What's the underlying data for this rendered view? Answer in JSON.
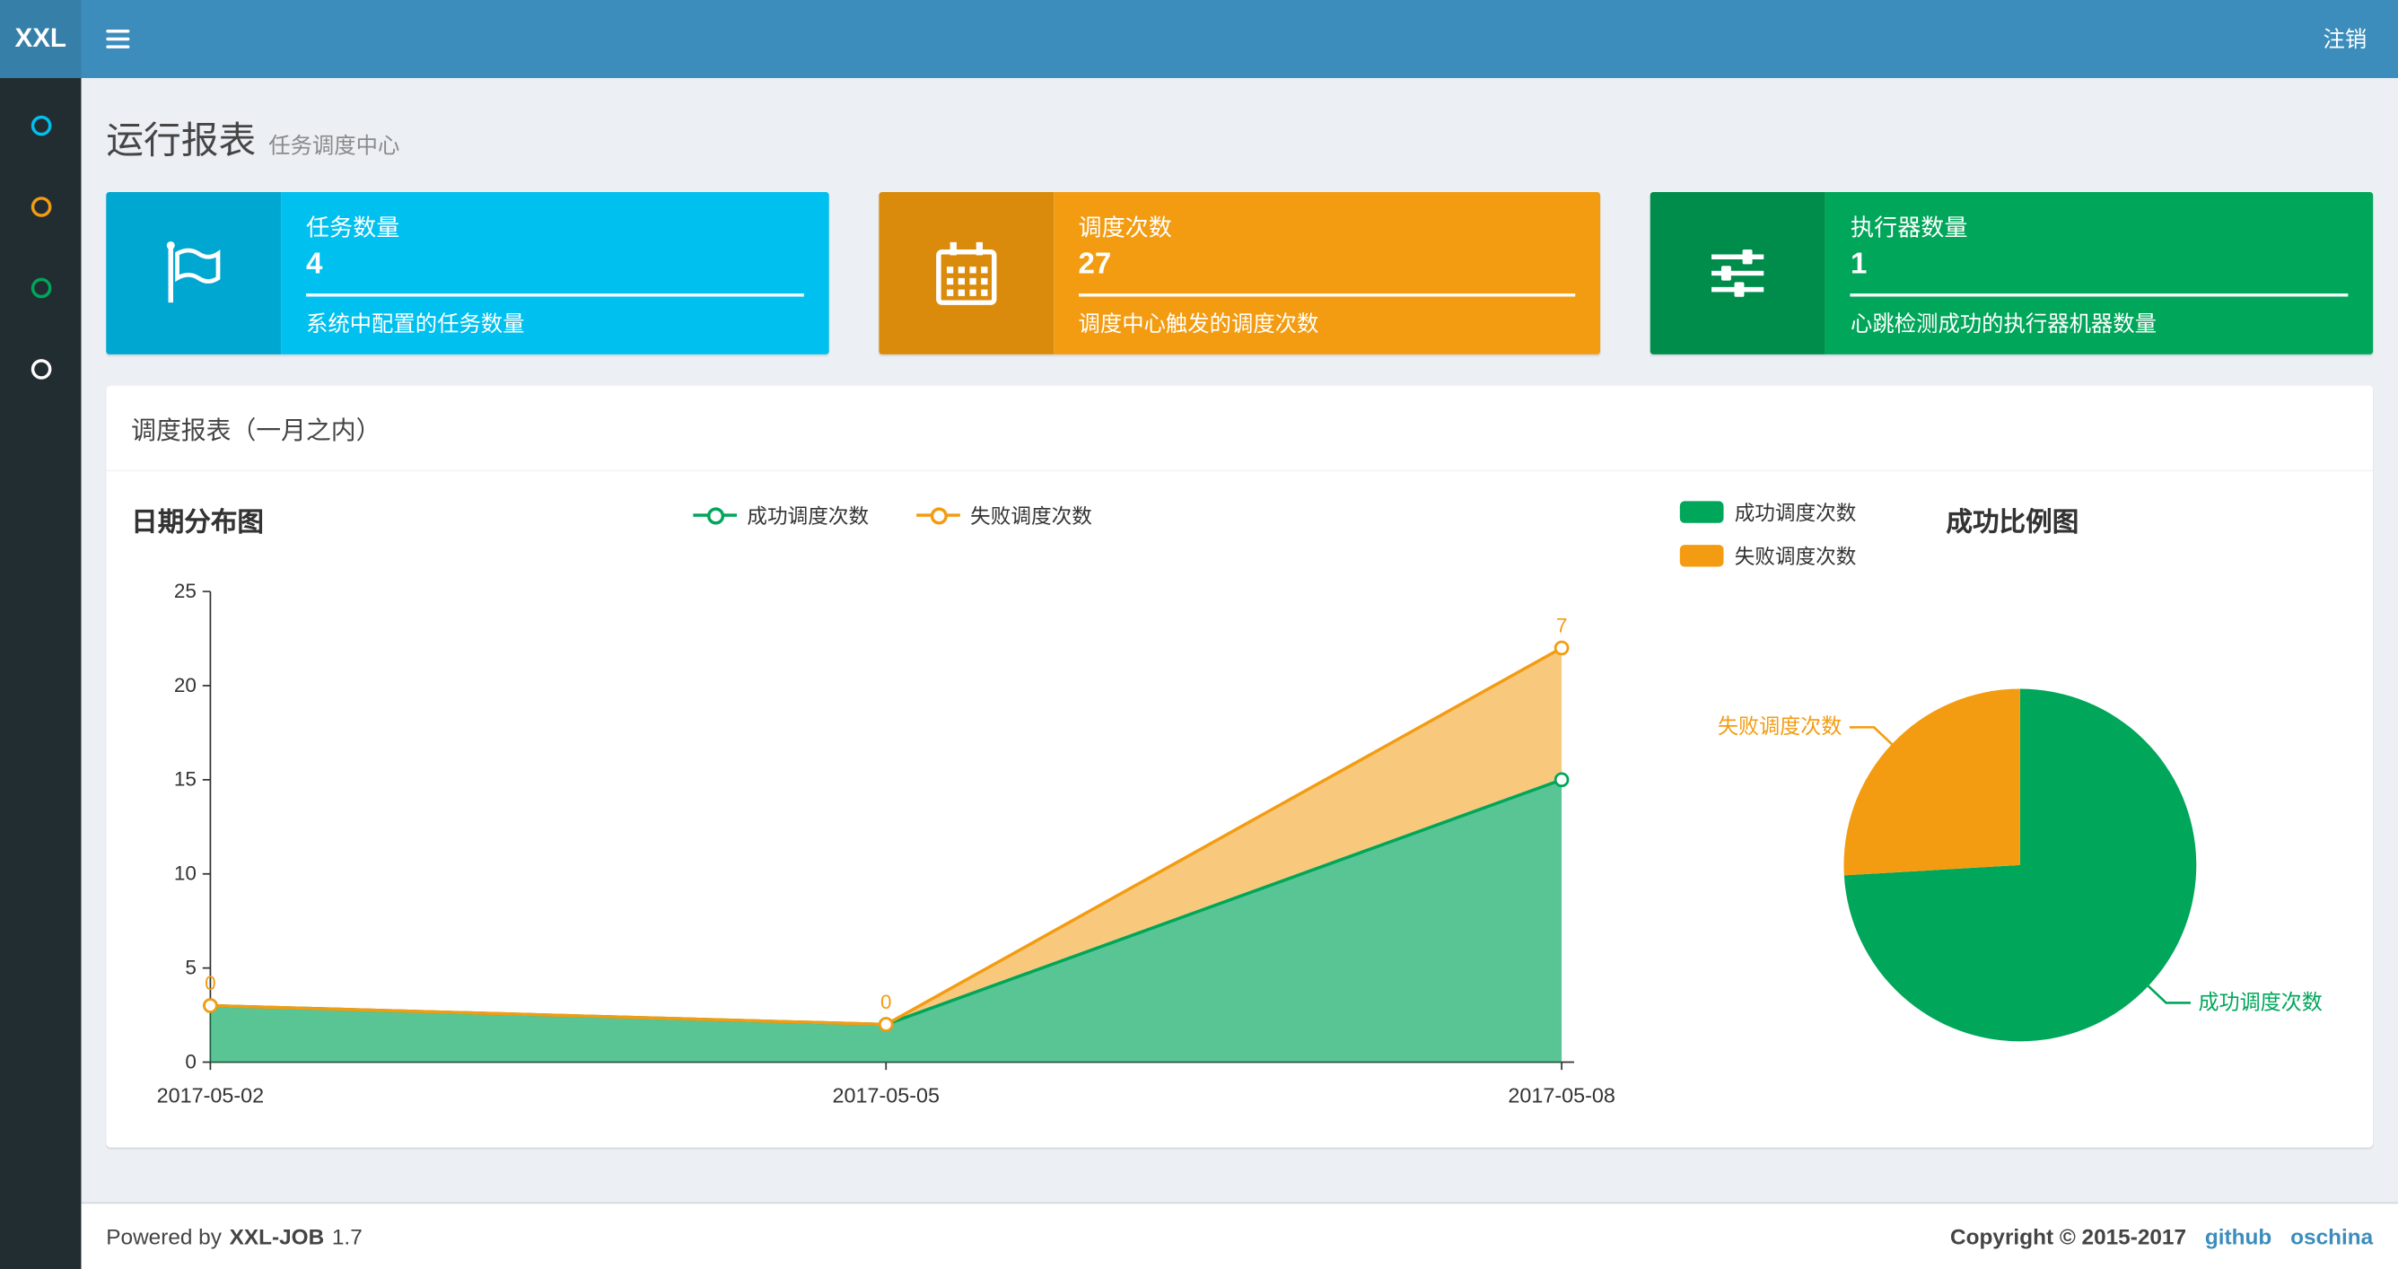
{
  "theme": {
    "navbar_bg": "#3c8dbc",
    "logo_bg": "#367fa9",
    "sidebar_bg": "#222d32",
    "content_bg": "#ecf0f5",
    "link_color": "#3c8dbc"
  },
  "navbar": {
    "logo": "XXL",
    "logout_label": "注销"
  },
  "sidebar": {
    "items": [
      {
        "icon": "circle-icon",
        "color": "#00c0ef"
      },
      {
        "icon": "circle-icon",
        "color": "#f39c12"
      },
      {
        "icon": "circle-icon",
        "color": "#00a65a"
      },
      {
        "icon": "circle-icon",
        "color": "#ffffff"
      }
    ]
  },
  "page_header": {
    "title": "运行报表",
    "subtitle": "任务调度中心"
  },
  "info_boxes": [
    {
      "title": "任务数量",
      "value": "4",
      "description": "系统中配置的任务数量",
      "color": "#00c0ef",
      "icon_bg": "#00a7d0",
      "icon": "flag-icon"
    },
    {
      "title": "调度次数",
      "value": "27",
      "description": "调度中心触发的调度次数",
      "color": "#f39c12",
      "icon_bg": "#db8b0b",
      "icon": "calendar-icon"
    },
    {
      "title": "执行器数量",
      "value": "1",
      "description": "心跳检测成功的执行器机器数量",
      "color": "#00a65a",
      "icon_bg": "#008d4c",
      "icon": "sliders-icon"
    }
  ],
  "report_panel": {
    "title": "调度报表（一月之内）"
  },
  "chart_data": [
    {
      "type": "area",
      "title": "日期分布图",
      "x": [
        "2017-05-02",
        "2017-05-05",
        "2017-05-08"
      ],
      "series": [
        {
          "name": "成功调度次数",
          "values": [
            3,
            2,
            15
          ],
          "color": "#00a65a"
        },
        {
          "name": "失败调度次数",
          "values": [
            0,
            0,
            7
          ],
          "color": "#f39c12",
          "stacked": true
        }
      ],
      "point_labels": {
        "series": "失败调度次数",
        "values": [
          "0",
          "0",
          "7"
        ]
      },
      "xlabel": "",
      "ylabel": "",
      "ylim": [
        0,
        25
      ],
      "yticks": [
        0,
        5,
        10,
        15,
        20,
        25
      ],
      "grid": false,
      "legend_position": "top-center"
    },
    {
      "type": "pie",
      "title": "成功比例图",
      "slices": [
        {
          "name": "成功调度次数",
          "value": 20,
          "color": "#00a65a"
        },
        {
          "name": "失败调度次数",
          "value": 7,
          "color": "#f39c12"
        }
      ],
      "start_angle": 90,
      "direction": "clockwise",
      "legend_position": "top-left"
    }
  ],
  "footer": {
    "powered_prefix": "Powered by",
    "product": "XXL-JOB",
    "version": "1.7",
    "copyright": "Copyright © 2015-2017",
    "links": [
      {
        "label": "github"
      },
      {
        "label": "oschina"
      }
    ]
  }
}
